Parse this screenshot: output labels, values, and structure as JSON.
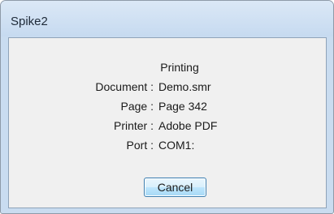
{
  "window": {
    "title": "Spike2"
  },
  "dialog": {
    "heading": "Printing",
    "fields": [
      {
        "label": "Document :",
        "value": "Demo.smr"
      },
      {
        "label": "Page :",
        "value": "Page 342"
      },
      {
        "label": "Printer :",
        "value": "Adobe PDF"
      },
      {
        "label": "Port :",
        "value": "COM1:"
      }
    ],
    "cancel_label": "Cancel"
  },
  "colors": {
    "titlebar": "#c6daf0",
    "client_bg": "#f0f0f0",
    "button_border": "#3c7fb1"
  }
}
